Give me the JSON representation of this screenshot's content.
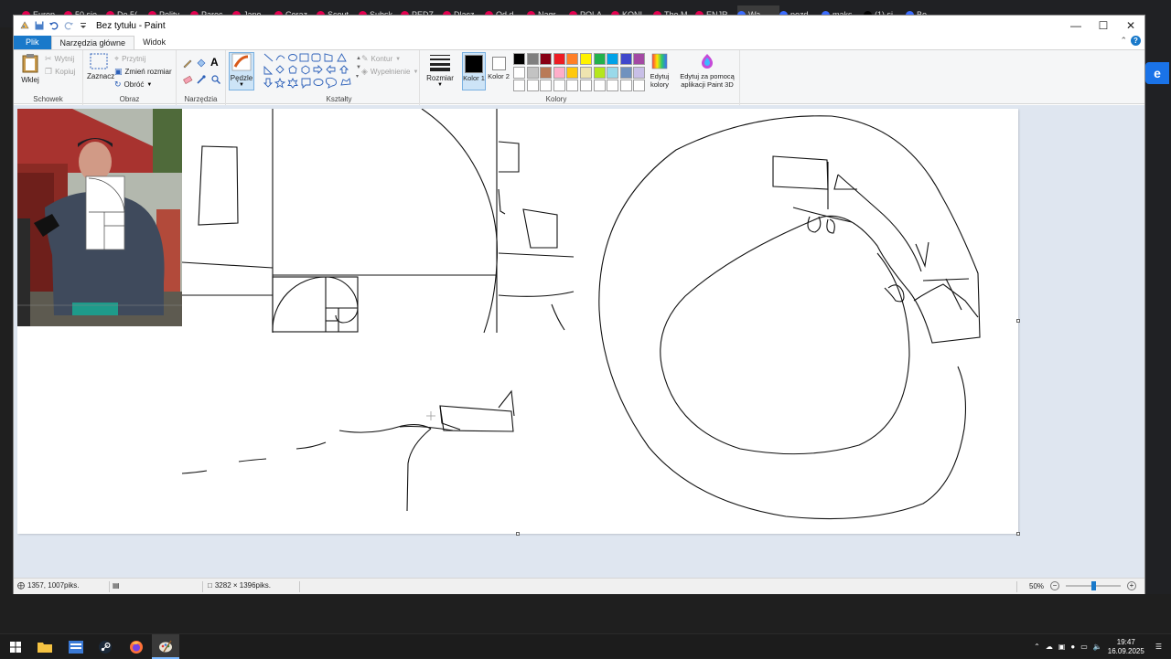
{
  "window": {
    "title": "Bez tytułu - Paint"
  },
  "browser_tabs": [
    "Europ",
    "50 sie",
    "Do 5(",
    "Polity",
    "Paręc",
    "Japo",
    "Coraz",
    "Scout",
    "Subsk",
    "PEDZ",
    "Dlacz",
    "Od d",
    "Nagr",
    "POLA",
    "KONI",
    "The M",
    "ENJR",
    "Wa",
    "pozd",
    "maks",
    "(1) si",
    "Bo"
  ],
  "browser_right_button": "e",
  "ribbon_tabs": {
    "file": "Plik",
    "home": "Narzędzia główne",
    "view": "Widok"
  },
  "clipboard": {
    "paste": "Wklej",
    "cut": "Wytnij",
    "copy": "Kopiuj",
    "group": "Schowek"
  },
  "image": {
    "select": "Zaznacz",
    "crop": "Przytnij",
    "resize": "Zmień rozmiar",
    "rotate": "Obróć",
    "group": "Obraz"
  },
  "tools": {
    "group": "Narzędzia"
  },
  "brushes": {
    "label": "Pędzle"
  },
  "shapes": {
    "outline": "Kontur",
    "fill": "Wypełnienie",
    "group": "Kształty"
  },
  "size": {
    "label": "Rozmiar"
  },
  "colors": {
    "color1": "Kolor 1",
    "color2": "Kolor 2",
    "edit": "Edytuj kolory",
    "paint3d": "Edytuj za pomocą aplikacji Paint 3D",
    "group": "Kolory",
    "palette_row1": [
      "#000000",
      "#7f7f7f",
      "#880015",
      "#ed1c24",
      "#ff7f27",
      "#fff200",
      "#22b14c",
      "#00a2e8",
      "#3f48cc",
      "#a349a4"
    ],
    "palette_row2": [
      "#ffffff",
      "#c3c3c3",
      "#b97a57",
      "#ffaec9",
      "#ffc90e",
      "#efe4b0",
      "#b5e61d",
      "#99d9ea",
      "#7092be",
      "#c8bfe7"
    ],
    "palette_row3": [
      "#ffffff",
      "#ffffff",
      "#ffffff",
      "#ffffff",
      "#ffffff",
      "#ffffff",
      "#ffffff",
      "#ffffff",
      "#ffffff",
      "#ffffff"
    ]
  },
  "status": {
    "cursor": "1357, 1007piks.",
    "size": "3282 × 1396piks.",
    "zoom": "50%",
    "zoom_fraction": 0.5
  },
  "taskbar": {
    "time": "19:47",
    "date": "16.09.2025"
  }
}
